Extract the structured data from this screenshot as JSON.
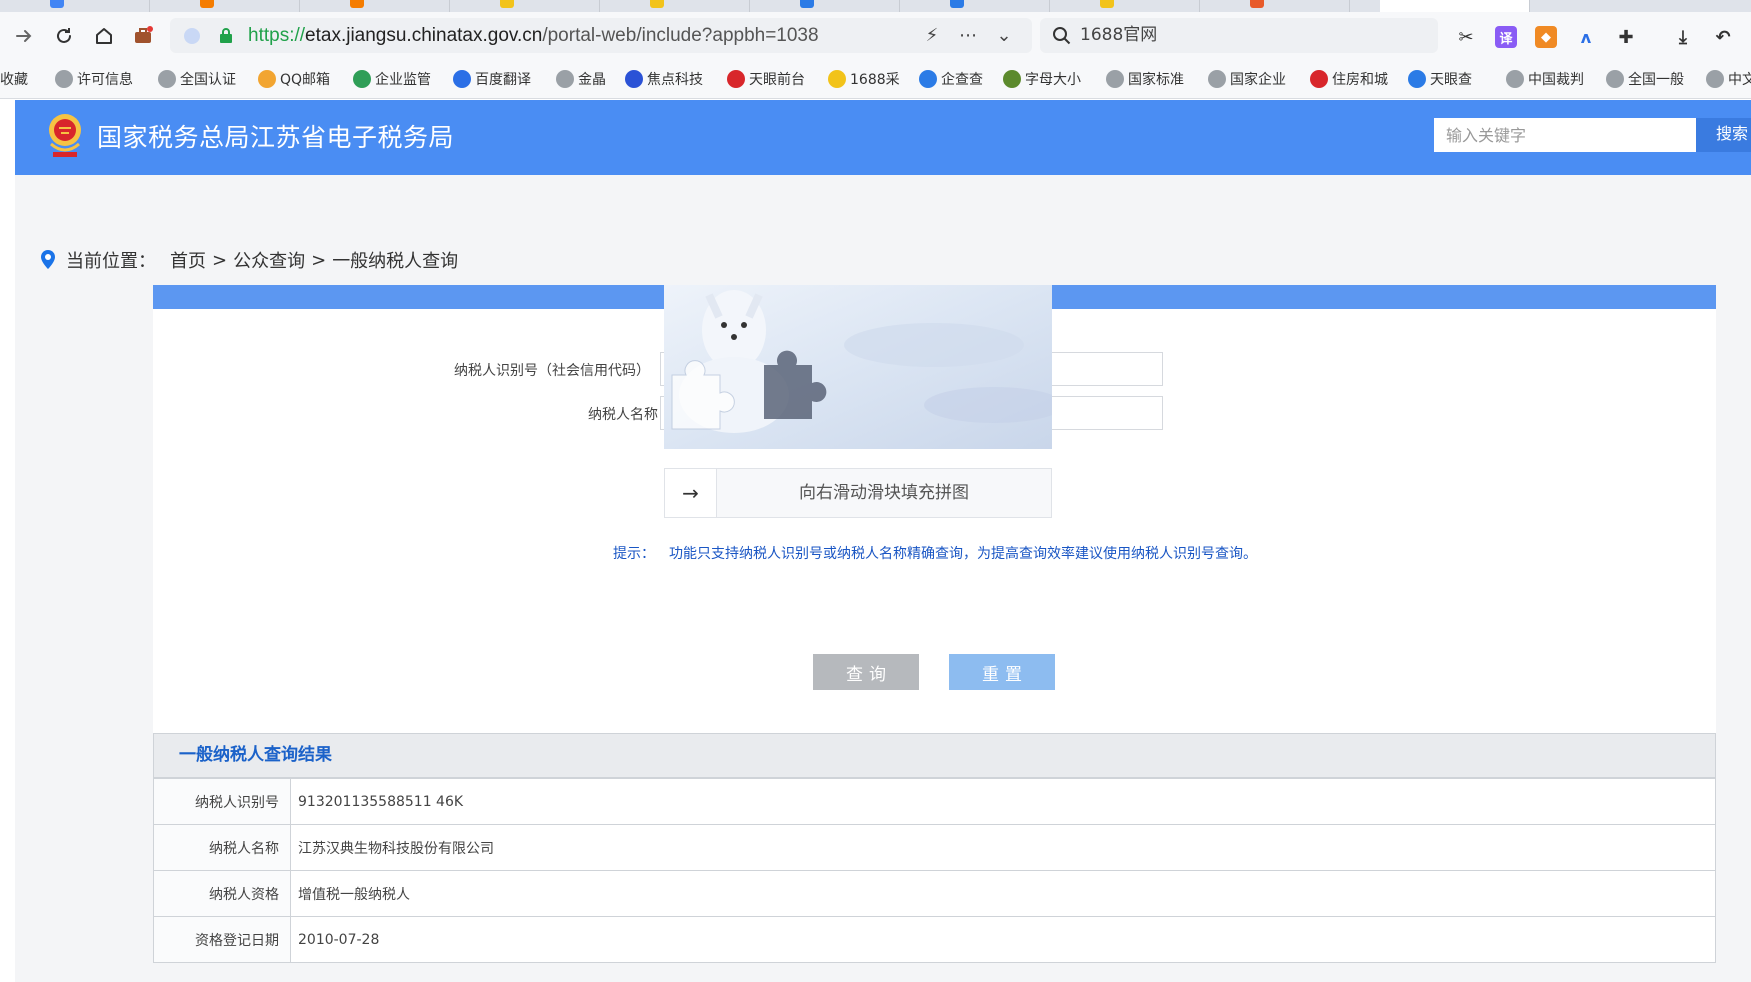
{
  "browser": {
    "url_scheme": "https://",
    "url_host": "etax.jiangsu.chinatax.gov.cn",
    "url_path": "/portal-web/include?appbh=1038",
    "search_text": "1688官网"
  },
  "bookmarks": [
    {
      "label": "收藏",
      "color": "#e8e8e8"
    },
    {
      "label": "许可信息",
      "color": "#9aa0a6"
    },
    {
      "label": "全国认证",
      "color": "#9aa0a6"
    },
    {
      "label": "QQ邮箱",
      "color": "#f2a531"
    },
    {
      "label": "企业监管",
      "color": "#2f9e57"
    },
    {
      "label": "百度翻译",
      "color": "#2b6fe6"
    },
    {
      "label": "金晶",
      "color": "#9aa0a6"
    },
    {
      "label": "焦点科技",
      "color": "#2b52d6"
    },
    {
      "label": "天眼前台",
      "color": "#d8262b"
    },
    {
      "label": "1688采",
      "color": "#f2c31a"
    },
    {
      "label": "企查查",
      "color": "#2b7be6"
    },
    {
      "label": "字母大小",
      "color": "#5c8a2d"
    },
    {
      "label": "国家标准",
      "color": "#9aa0a6"
    },
    {
      "label": "国家企业",
      "color": "#9aa0a6"
    },
    {
      "label": "住房和城",
      "color": "#d8262b"
    },
    {
      "label": "天眼查",
      "color": "#2b7be6"
    },
    {
      "label": "中国裁判",
      "color": "#9aa0a6"
    },
    {
      "label": "全国一般",
      "color": "#9aa0a6"
    },
    {
      "label": "中文",
      "color": "#9aa0a6"
    }
  ],
  "header": {
    "site_title": "国家税务总局江苏省电子税务局",
    "search_placeholder": "输入关键字",
    "search_button": "搜索"
  },
  "breadcrumb": {
    "prefix": "当前位置：",
    "items": [
      "首页",
      "公众查询",
      "一般纳税人查询"
    ],
    "separator": ">"
  },
  "form": {
    "taxpayer_id_label": "纳税人识别号（社会信用代码）",
    "taxpayer_name_label": "纳税人名称",
    "slider_text": "向右滑动滑块填充拼图",
    "tip_prefix": "提示：",
    "tip_text": "功能只支持纳税人识别号或纳税人名称精确查询，为提高查询效率建议使用纳税人识别号查询。",
    "query_button": "查询",
    "reset_button": "重置"
  },
  "results": {
    "title": "一般纳税人查询结果",
    "rows": [
      {
        "key": "纳税人识别号",
        "value": "913201135588511 46K"
      },
      {
        "key": "纳税人名称",
        "value": "江苏汉典生物科技股份有限公司"
      },
      {
        "key": "纳税人资格",
        "value": "增值税一般纳税人"
      },
      {
        "key": "资格登记日期",
        "value": "2010-07-28"
      }
    ]
  },
  "colors": {
    "header_blue": "#4a8df3",
    "panel_bar": "#5c97f1",
    "results_title": "#1b62c9",
    "tip": "#1a56c4"
  }
}
